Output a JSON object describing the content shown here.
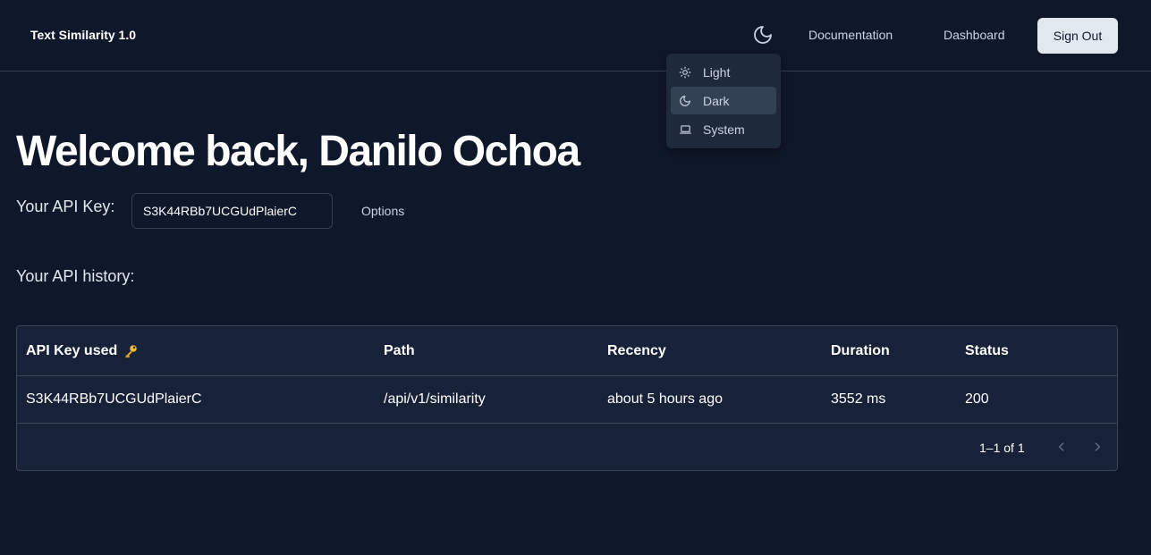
{
  "navbar": {
    "brand": "Text Similarity 1.0",
    "links": {
      "documentation": "Documentation",
      "dashboard": "Dashboard"
    },
    "sign_out": "Sign Out"
  },
  "theme_menu": {
    "items": [
      {
        "label": "Light",
        "icon": "sun-icon",
        "active": false
      },
      {
        "label": "Dark",
        "icon": "moon-icon",
        "active": true
      },
      {
        "label": "System",
        "icon": "laptop-icon",
        "active": false
      }
    ]
  },
  "main": {
    "welcome": "Welcome back, Danilo Ochoa",
    "api_key_label": "Your API Key:",
    "api_key_value": "S3K44RBb7UCGUdPlaierC",
    "options_label": "Options",
    "history_label": "Your API history:"
  },
  "table": {
    "columns": [
      "API Key used",
      "Path",
      "Recency",
      "Duration",
      "Status"
    ],
    "key_icon": "🔑",
    "rows": [
      {
        "api_key": "S3K44RBb7UCGUdPlaierC",
        "path": "/api/v1/similarity",
        "recency": "about 5 hours ago",
        "duration": "3552 ms",
        "status": "200"
      }
    ],
    "pagination": "1–1 of 1"
  },
  "colors": {
    "background": "#0f172a",
    "table_background": "#172238",
    "menu_background": "#1e293b",
    "menu_active": "#334155",
    "button_background": "#e2e8f0"
  }
}
